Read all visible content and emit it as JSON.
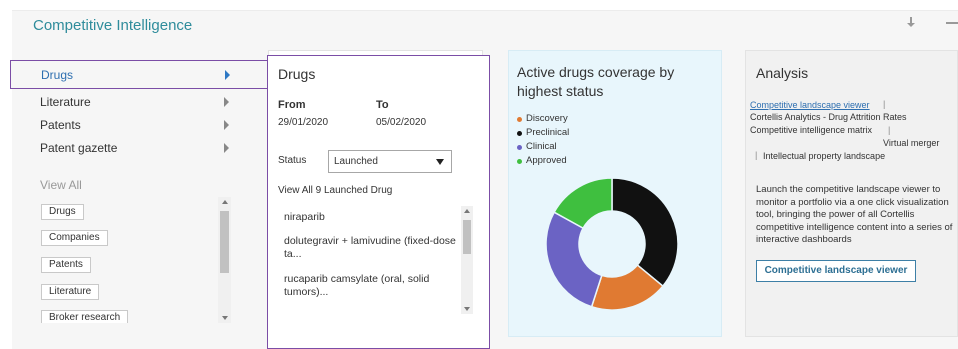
{
  "header": {
    "title": "Competitive Intelligence"
  },
  "nav": {
    "items": [
      {
        "label": "Drugs",
        "active": true
      },
      {
        "label": "Literature",
        "active": false
      },
      {
        "label": "Patents",
        "active": false
      },
      {
        "label": "Patent gazette",
        "active": false
      }
    ],
    "view_all_label": "View All",
    "view_all_items": [
      "Drugs",
      "Companies",
      "Patents",
      "Literature",
      "Broker research"
    ]
  },
  "drugs_panel": {
    "title": "Drugs",
    "from_label": "From",
    "from_value": "29/01/2020",
    "to_label": "To",
    "to_value": "05/02/2020",
    "status_label": "Status",
    "status_value": "Launched",
    "view_all_text": "View All 9 Launched Drug",
    "drugs": [
      "niraparib",
      "dolutegravir + lamivudine (fixed-dose ta...",
      "rucaparib camsylate (oral, solid tumors)..."
    ]
  },
  "coverage": {
    "title": "Active drugs coverage by highest status",
    "legend": [
      {
        "label": "Discovery",
        "color": "#e07a32"
      },
      {
        "label": "Preclinical",
        "color": "#111111"
      },
      {
        "label": "Clinical",
        "color": "#6b63c4"
      },
      {
        "label": "Approved",
        "color": "#3fbf3f"
      }
    ]
  },
  "chart_data": {
    "type": "pie",
    "donut": true,
    "categories": [
      "Preclinical",
      "Discovery",
      "Clinical",
      "Approved"
    ],
    "values": [
      36,
      19,
      28,
      17
    ],
    "colors": [
      "#111111",
      "#e07a32",
      "#6b63c4",
      "#3fbf3f"
    ]
  },
  "analysis": {
    "title": "Analysis",
    "link_text": "Competitive landscape viewer",
    "sep": "|",
    "line2": "Cortellis Analytics - Drug Attrition Rates",
    "line3": "Competitive intelligence matrix",
    "line4": "Virtual merger",
    "line5": "Intellectual property landscape",
    "description": "Launch the competitive landscape viewer to monitor a portfolio via a one click visualization tool, bringing the power of all Cortellis competitive intelligence content into a series of interactive dashboards",
    "button_label": "Competitive landscape viewer"
  }
}
